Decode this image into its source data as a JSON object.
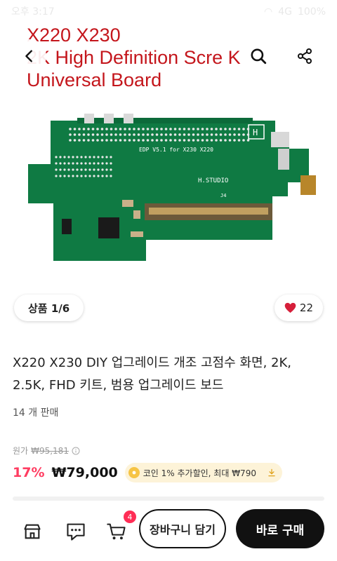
{
  "status_bar": {
    "time": "오후 3:17",
    "signal": "4G",
    "battery": "100%"
  },
  "hero": {
    "title_lines": [
      "X220 X230",
      "2K High Definition Scre   K",
      "Universal Board"
    ],
    "pcb_labels": {
      "board": "EDP V5.1 for X230 X220",
      "studio": "H.STUDIO",
      "logo": "H",
      "j4": "J4"
    }
  },
  "pager": {
    "label": "상품 1/6"
  },
  "like": {
    "count": "22"
  },
  "product": {
    "title": "X220 X230 DIY 업그레이드 개조 고점수 화면, 2K, 2.5K, FHD 키트, 범용 업그레이드 보드",
    "sold": "14 개 판매",
    "original_label": "원가",
    "original_price": "₩95,181",
    "discount": "17%",
    "price": "₩79,000",
    "coin_text": "코인 1% 추가할인, 최대 ₩790"
  },
  "bottom_bar": {
    "cart_badge": "4",
    "add_to_cart": "장바구니 담기",
    "buy_now": "바로 구매"
  },
  "colors": {
    "accent": "#ff3c61",
    "title_red": "#c4161c",
    "pcb_green": "#0f7a43",
    "coin_bg": "#fdf3d8"
  }
}
